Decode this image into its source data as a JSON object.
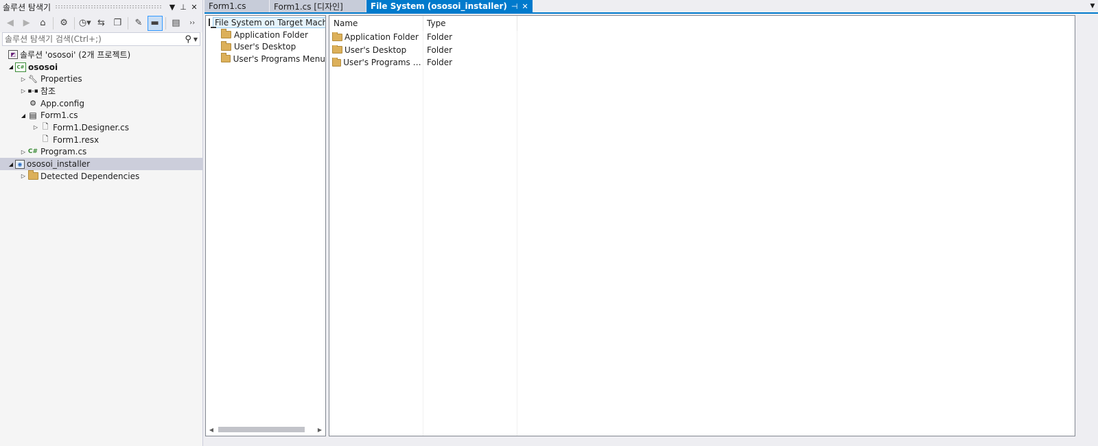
{
  "solution_explorer": {
    "title": "솔루션 탐색기",
    "search_placeholder": "솔루션 탐색기 검색(Ctrl+;)",
    "toolbar_overflow": "››",
    "tree": [
      {
        "label": "솔루션 'ososoi' (2개 프로젝트)",
        "icon": "solution-icon",
        "depth": 0,
        "expander": "",
        "bold": false
      },
      {
        "label": "ososoi",
        "icon": "csharp-project-icon",
        "depth": 0,
        "expander": "collapse",
        "bold": true
      },
      {
        "label": "Properties",
        "icon": "wrench-icon",
        "depth": 1,
        "expander": "expand",
        "bold": false
      },
      {
        "label": "참조",
        "icon": "references-icon",
        "depth": 1,
        "expander": "expand",
        "bold": false
      },
      {
        "label": "App.config",
        "icon": "config-file-icon",
        "depth": 1,
        "expander": "",
        "bold": false
      },
      {
        "label": "Form1.cs",
        "icon": "form-icon",
        "depth": 1,
        "expander": "collapse",
        "bold": false
      },
      {
        "label": "Form1.Designer.cs",
        "icon": "code-file-icon",
        "depth": 2,
        "expander": "expand",
        "bold": false
      },
      {
        "label": "Form1.resx",
        "icon": "resource-file-icon",
        "depth": 2,
        "expander": "",
        "bold": false
      },
      {
        "label": "Program.cs",
        "icon": "csharp-file-icon",
        "depth": 1,
        "expander": "expand",
        "bold": false
      },
      {
        "label": "ososoi_installer",
        "icon": "setup-project-icon",
        "depth": 0,
        "expander": "collapse",
        "bold": false,
        "selected": true
      },
      {
        "label": "Detected Dependencies",
        "icon": "folder-icon",
        "depth": 1,
        "expander": "expand",
        "bold": false
      }
    ]
  },
  "tabs": [
    {
      "label": "Form1.cs",
      "active": false
    },
    {
      "label": "Form1.cs [디자인]",
      "active": false
    },
    {
      "label": "File System (ososoi_installer)",
      "active": true
    }
  ],
  "fs_tree": {
    "root": "File System on Target Mach",
    "children": [
      "Application Folder",
      "User's Desktop",
      "User's Programs Menu"
    ]
  },
  "fs_list": {
    "columns": [
      "Name",
      "Type"
    ],
    "rows": [
      {
        "name": "Application Folder",
        "type": "Folder"
      },
      {
        "name": "User's Desktop",
        "type": "Folder"
      },
      {
        "name": "User's Programs Menu",
        "type": "Folder"
      }
    ]
  },
  "colors": {
    "accent": "#007acc",
    "selection": "#cccedb",
    "folder": "#dcb05a"
  }
}
